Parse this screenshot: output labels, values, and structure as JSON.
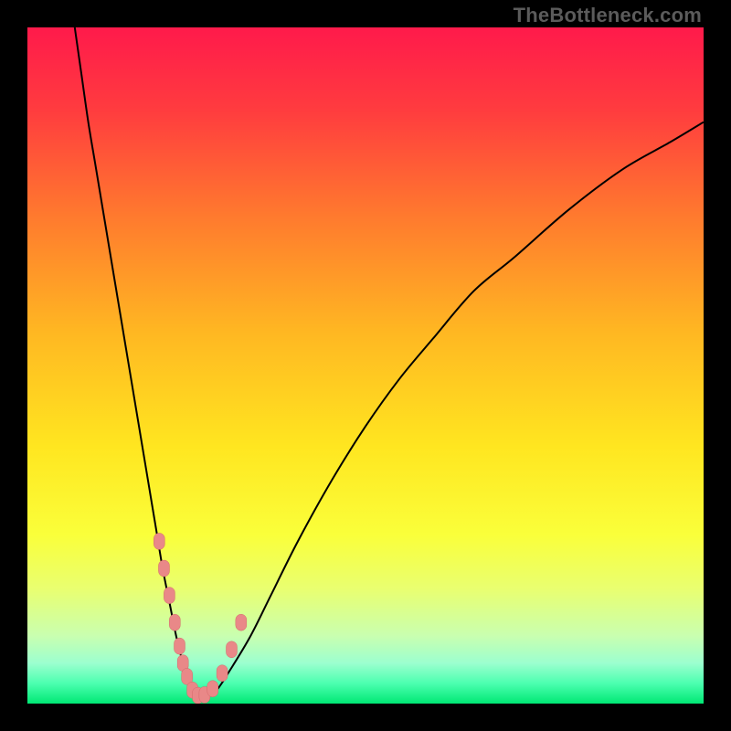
{
  "watermark": "TheBottleneck.com",
  "colors": {
    "gradient": [
      {
        "offset": 0.0,
        "color": "#ff1a4b"
      },
      {
        "offset": 0.12,
        "color": "#ff3b3f"
      },
      {
        "offset": 0.28,
        "color": "#ff7a2e"
      },
      {
        "offset": 0.45,
        "color": "#ffb722"
      },
      {
        "offset": 0.62,
        "color": "#ffe620"
      },
      {
        "offset": 0.75,
        "color": "#faff3a"
      },
      {
        "offset": 0.83,
        "color": "#e9ff70"
      },
      {
        "offset": 0.9,
        "color": "#c9ffb0"
      },
      {
        "offset": 0.94,
        "color": "#9cffcf"
      },
      {
        "offset": 0.97,
        "color": "#4cffb0"
      },
      {
        "offset": 1.0,
        "color": "#00e874"
      }
    ],
    "curve_stroke": "#000000",
    "marker_fill": "#e98888",
    "marker_stroke": "#d56a6a"
  },
  "chart_data": {
    "type": "line",
    "title": "",
    "xlabel": "",
    "ylabel": "",
    "xlim": [
      0,
      100
    ],
    "ylim": [
      0,
      100
    ],
    "grid": false,
    "series": [
      {
        "name": "bottleneck-curve",
        "x": [
          7,
          8,
          9,
          10,
          11,
          12,
          13,
          14,
          15,
          16,
          17,
          18,
          19,
          20,
          21,
          22,
          23,
          24,
          24.8,
          25.5,
          26.5,
          28,
          30,
          33,
          36,
          40,
          45,
          50,
          55,
          60,
          66,
          72,
          80,
          88,
          95,
          100
        ],
        "y": [
          100,
          93,
          86,
          80,
          74,
          68,
          62,
          56,
          50,
          44,
          38,
          32,
          26,
          20,
          15,
          10,
          6,
          3,
          1.5,
          1,
          1.1,
          2,
          5,
          10,
          16,
          24,
          33,
          41,
          48,
          54,
          61,
          66,
          73,
          79,
          83,
          86
        ]
      }
    ],
    "markers": {
      "name": "highlight-points",
      "x": [
        19.5,
        20.2,
        21.0,
        21.8,
        22.5,
        23.0,
        23.6,
        24.4,
        25.2,
        26.2,
        27.4,
        28.8,
        30.2,
        31.6
      ],
      "y": [
        24,
        20,
        16,
        12,
        8.5,
        6,
        4,
        2,
        1.2,
        1.3,
        2.2,
        4.5,
        8,
        12
      ]
    }
  }
}
